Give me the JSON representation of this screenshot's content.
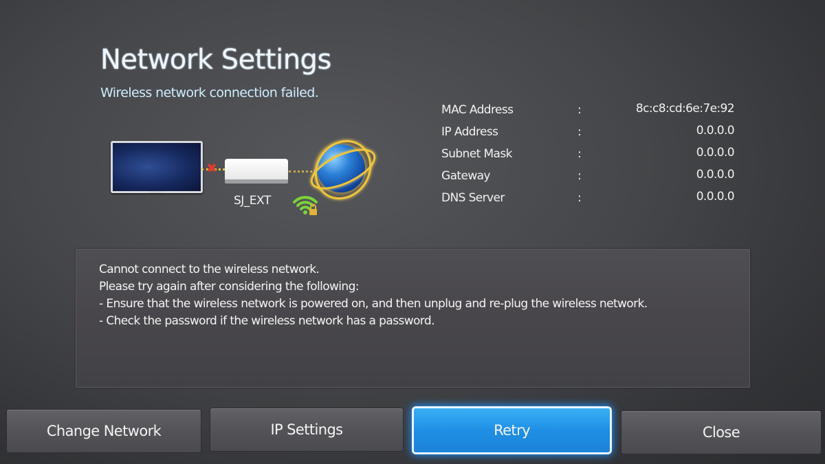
{
  "header": {
    "title": "Network Settings",
    "subtitle": "Wireless network connection failed."
  },
  "diagram": {
    "network_name": "SJ_EXT",
    "connection_status": "failed",
    "icons": [
      "tv-icon",
      "disconnected-x-icon",
      "router-icon",
      "globe-icon",
      "wifi-locked-icon"
    ]
  },
  "network_info": [
    {
      "label": "MAC Address",
      "separator": ":",
      "value": "8c:c8:cd:6e:7e:92"
    },
    {
      "label": "IP Address",
      "separator": ":",
      "value": "0.0.0.0"
    },
    {
      "label": "Subnet Mask",
      "separator": ":",
      "value": "0.0.0.0"
    },
    {
      "label": "Gateway",
      "separator": ":",
      "value": "0.0.0.0"
    },
    {
      "label": "DNS Server",
      "separator": ":",
      "value": "0.0.0.0"
    }
  ],
  "message": {
    "lines": [
      "Cannot connect to the wireless network.",
      "Please try again after considering the following:",
      "- Ensure that the wireless network is powered on, and then unplug and re-plug the wireless network.",
      "- Check the password if the wireless network has a password."
    ]
  },
  "buttons": {
    "change_network": "Change Network",
    "ip_settings": "IP Settings",
    "retry": "Retry",
    "close": "Close",
    "focused": "Retry"
  },
  "colors": {
    "accent_focus": "#1f8fe4",
    "link_status": "#e8c23c",
    "error_x": "#e03a2e",
    "wifi_green": "#7cd33a"
  }
}
